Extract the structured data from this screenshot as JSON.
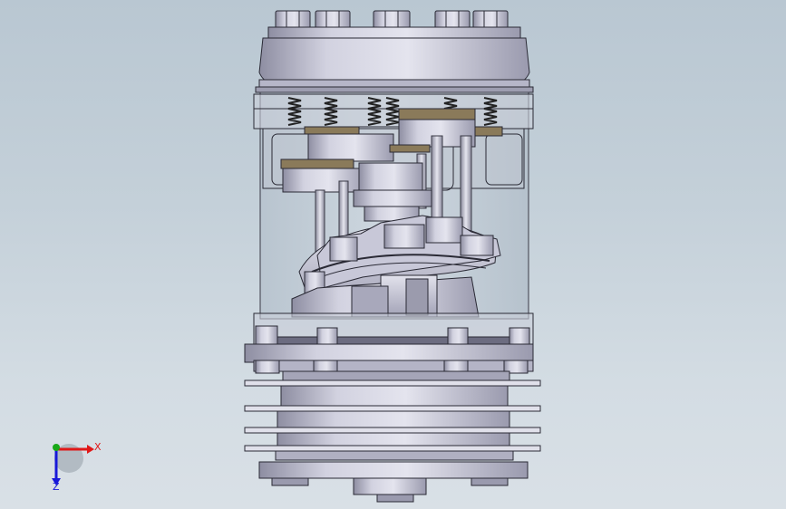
{
  "viewport": {
    "background_top": "#b9c7d2",
    "background_bottom": "#d9e0e6",
    "model_colors": {
      "metal_light": "#d9d9e6",
      "metal_mid": "#b2b2c4",
      "metal_dark": "#7c7c90",
      "edge": "#2a2a35",
      "brass": "#8a7a5a",
      "glass": "#c8d4de"
    }
  },
  "triad": {
    "x_label": "X",
    "z_label": "Z",
    "x_color": "#e01818",
    "y_color": "#18a818",
    "z_color": "#1818d8"
  }
}
